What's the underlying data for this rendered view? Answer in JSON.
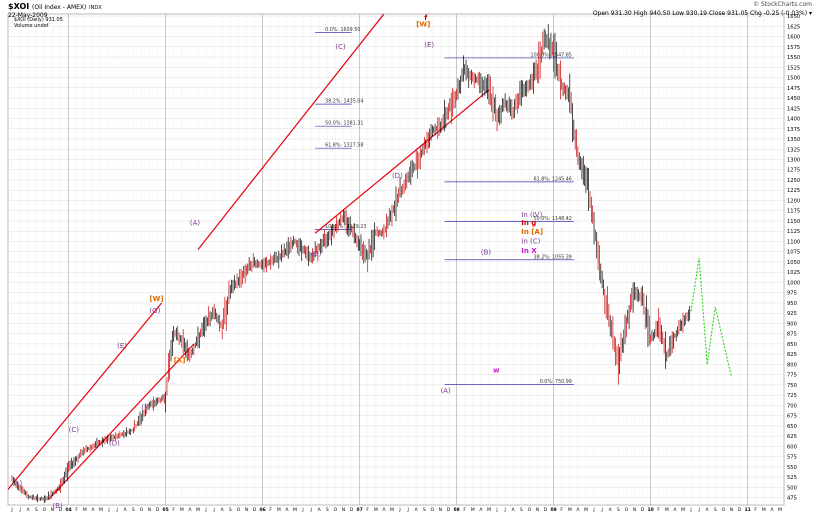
{
  "header": {
    "symbol": "$XOI",
    "name": "(Oil Index - AMEX)",
    "exchange": "INDX",
    "date": "22-May-2009",
    "legend": "$XOI (Daily) 931.05",
    "volume_label": "Volume undef",
    "watermark": "© StockCharts.com",
    "ohlc": "Open 931.30   High 940.50   Low 930.19   Close 931.05   Chg -0.25 (-0.03%) ▾"
  },
  "colors": {
    "price_bars": "#000000",
    "channel": "#e8000b",
    "fib_lines": "#3b3bb5",
    "projection": "#2fd31f",
    "wave_purple": "#7a3a8c",
    "wave_orange": "#e06a00"
  },
  "chart_data": {
    "type": "ohlc",
    "title": "$XOI (Oil Index - AMEX)",
    "subtitle": "$XOI (Daily) 931.05",
    "ylim": [
      457,
      1655
    ],
    "y_ticks": [
      475,
      500,
      525,
      550,
      575,
      600,
      625,
      650,
      675,
      700,
      725,
      750,
      775,
      800,
      825,
      850,
      875,
      900,
      925,
      950,
      975,
      1000,
      1025,
      1050,
      1075,
      1100,
      1125,
      1150,
      1175,
      1200,
      1225,
      1250,
      1275,
      1300,
      1325,
      1350,
      1375,
      1400,
      1425,
      1450,
      1475,
      1500,
      1525,
      1550,
      1575,
      1600,
      1625,
      1650
    ],
    "x_year_labels": [
      "04",
      "05",
      "06",
      "07",
      "08",
      "09",
      "10",
      "11"
    ],
    "x_months": [
      "J",
      "J",
      "A",
      "S",
      "O",
      "N",
      "D",
      "04",
      "F",
      "M",
      "A",
      "M",
      "J",
      "J",
      "A",
      "S",
      "O",
      "N",
      "D",
      "05",
      "F",
      "M",
      "A",
      "M",
      "J",
      "J",
      "A",
      "S",
      "O",
      "N",
      "D",
      "06",
      "F",
      "M",
      "A",
      "M",
      "J",
      "J",
      "A",
      "S",
      "O",
      "N",
      "D",
      "07",
      "F",
      "M",
      "A",
      "M",
      "J",
      "J",
      "A",
      "S",
      "O",
      "N",
      "D",
      "08",
      "F",
      "M",
      "A",
      "M",
      "J",
      "J",
      "A",
      "S",
      "O",
      "N",
      "D",
      "09",
      "F",
      "M",
      "A",
      "M",
      "J",
      "J",
      "A",
      "S",
      "O",
      "N",
      "D",
      "10",
      "F",
      "M",
      "A",
      "M",
      "J",
      "J",
      "A",
      "S",
      "O",
      "N",
      "D",
      "11",
      "F",
      "M",
      "A",
      "M"
    ],
    "price_path": [
      [
        0,
        520
      ],
      [
        2,
        478
      ],
      [
        4,
        470
      ],
      [
        6,
        500
      ],
      [
        7,
        550
      ],
      [
        9,
        590
      ],
      [
        11,
        610
      ],
      [
        13,
        625
      ],
      [
        15,
        640
      ],
      [
        17,
        700
      ],
      [
        19,
        720
      ],
      [
        20,
        880
      ],
      [
        21,
        860
      ],
      [
        22,
        820
      ],
      [
        24,
        900
      ],
      [
        25,
        930
      ],
      [
        26,
        890
      ],
      [
        27,
        980
      ],
      [
        29,
        1030
      ],
      [
        30,
        1050
      ],
      [
        31,
        1040
      ],
      [
        33,
        1060
      ],
      [
        35,
        1100
      ],
      [
        37,
        1060
      ],
      [
        39,
        1110
      ],
      [
        41,
        1160
      ],
      [
        42,
        1130
      ],
      [
        44,
        1060
      ],
      [
        45,
        1120
      ],
      [
        46,
        1120
      ],
      [
        48,
        1220
      ],
      [
        50,
        1290
      ],
      [
        52,
        1370
      ],
      [
        53,
        1380
      ],
      [
        55,
        1460
      ],
      [
        56,
        1520
      ],
      [
        57,
        1500
      ],
      [
        58,
        1490
      ],
      [
        59,
        1470
      ],
      [
        60,
        1400
      ],
      [
        61,
        1440
      ],
      [
        62,
        1420
      ],
      [
        63,
        1460
      ],
      [
        64,
        1480
      ],
      [
        65,
        1520
      ],
      [
        66,
        1600
      ],
      [
        67,
        1560
      ],
      [
        68,
        1480
      ],
      [
        69,
        1460
      ],
      [
        70,
        1300
      ],
      [
        71,
        1260
      ],
      [
        72,
        1140
      ],
      [
        73,
        1000
      ],
      [
        74,
        900
      ],
      [
        75,
        800
      ],
      [
        76,
        900
      ],
      [
        77,
        980
      ],
      [
        78,
        960
      ],
      [
        79,
        860
      ],
      [
        80,
        900
      ],
      [
        81,
        820
      ],
      [
        82,
        870
      ],
      [
        83,
        900
      ],
      [
        84,
        930
      ]
    ],
    "projection": [
      [
        84,
        930
      ],
      [
        85,
        1060
      ],
      [
        86,
        800
      ],
      [
        87,
        940
      ],
      [
        89,
        770
      ]
    ],
    "fib_levels": [
      {
        "label": "0.0%: 1609.50",
        "value": 1609.5
      },
      {
        "label": "38.2%: 1435.04",
        "value": 1435.04
      },
      {
        "label": "50.0%: 1381.31",
        "value": 1381.31
      },
      {
        "label": "61.8%: 1327.58",
        "value": 1327.58
      },
      {
        "label": "100.0%: 1129.23",
        "value": 1129.23
      },
      {
        "label": "100.0%: 1547.85",
        "value": 1547.85
      },
      {
        "label": "61.8%: 1245.46",
        "value": 1245.46
      },
      {
        "label": "50.0%: 1148.42",
        "value": 1148.42
      },
      {
        "label": "38.2%: 1055.39",
        "value": 1055.39
      },
      {
        "label": "0.0%: 750.99",
        "value": 750.99
      }
    ],
    "wave_labels": [
      {
        "text": "(A)",
        "x": 0,
        "y": 505,
        "color": "purple"
      },
      {
        "text": "(B)",
        "x": 5,
        "y": 450,
        "color": "purple"
      },
      {
        "text": "(C)",
        "x": 7,
        "y": 635,
        "color": "purple"
      },
      {
        "text": "(D)",
        "x": 12,
        "y": 602,
        "color": "purple"
      },
      {
        "text": "(E)",
        "x": 13,
        "y": 840,
        "color": "purple"
      },
      {
        "text": "(F)",
        "x": 16,
        "y": 690,
        "color": "purple"
      },
      {
        "text": "(G)",
        "x": 17,
        "y": 925,
        "color": "purple"
      },
      {
        "text": "[W]",
        "x": 17,
        "y": 955,
        "color": "orange"
      },
      {
        "text": "[X]",
        "x": 20,
        "y": 805,
        "color": "orange"
      },
      {
        "text": "(A)",
        "x": 22,
        "y": 1140,
        "color": "purple"
      },
      {
        "text": "(B)",
        "x": 37,
        "y": 1065,
        "color": "purple"
      },
      {
        "text": "(C)",
        "x": 40,
        "y": 1570,
        "color": "purple"
      },
      {
        "text": "(D)",
        "x": 47,
        "y": 1255,
        "color": "purple"
      },
      {
        "text": "[W]",
        "x": 50,
        "y": 1625,
        "color": "orange"
      },
      {
        "text": "f",
        "x": 51,
        "y": 1640,
        "color": "red"
      },
      {
        "text": "(E)",
        "x": 51,
        "y": 1575,
        "color": "purple"
      },
      {
        "text": "(B)",
        "x": 58,
        "y": 1068,
        "color": "purple"
      },
      {
        "text": "(A)",
        "x": 53,
        "y": 730,
        "color": "purple"
      },
      {
        "text": "w",
        "x": 59.5,
        "y": 780,
        "color": "magenta"
      },
      {
        "text": "In (IV)",
        "x": 63,
        "y": 1160,
        "color": "purple"
      },
      {
        "text": "In g",
        "x": 63,
        "y": 1140,
        "color": "red"
      },
      {
        "text": "In [A]",
        "x": 63,
        "y": 1118,
        "color": "orange"
      },
      {
        "text": "In (C)",
        "x": 63,
        "y": 1095,
        "color": "purple"
      },
      {
        "text": "In X",
        "x": 63,
        "y": 1072,
        "color": "magenta"
      }
    ]
  }
}
